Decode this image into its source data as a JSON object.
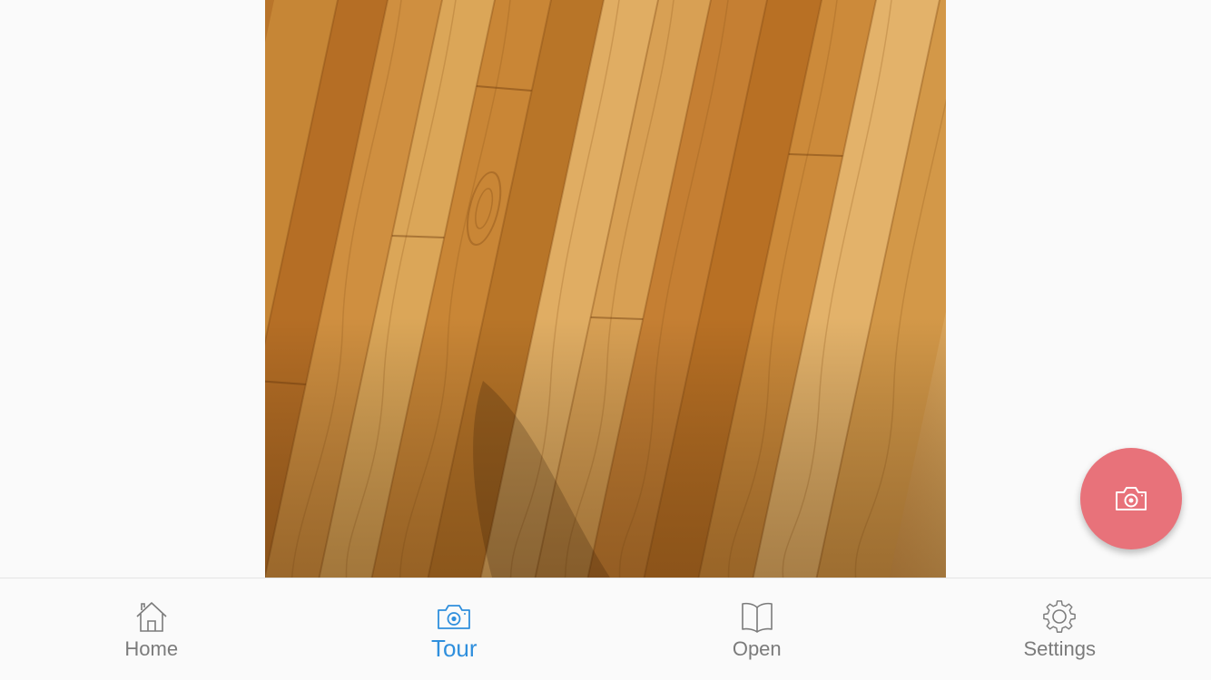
{
  "photo": {
    "subject": "wood-floor-photo"
  },
  "fab": {
    "icon": "camera-icon",
    "color": "#e8727a"
  },
  "tabbar": {
    "accent": "#2f8fdd",
    "inactive_color": "#7b7b7b",
    "items": [
      {
        "label": "Home",
        "icon": "home-icon",
        "active": false
      },
      {
        "label": "Tour",
        "icon": "camera-icon",
        "active": true
      },
      {
        "label": "Open",
        "icon": "book-icon",
        "active": false
      },
      {
        "label": "Settings",
        "icon": "gear-icon",
        "active": false
      }
    ]
  }
}
